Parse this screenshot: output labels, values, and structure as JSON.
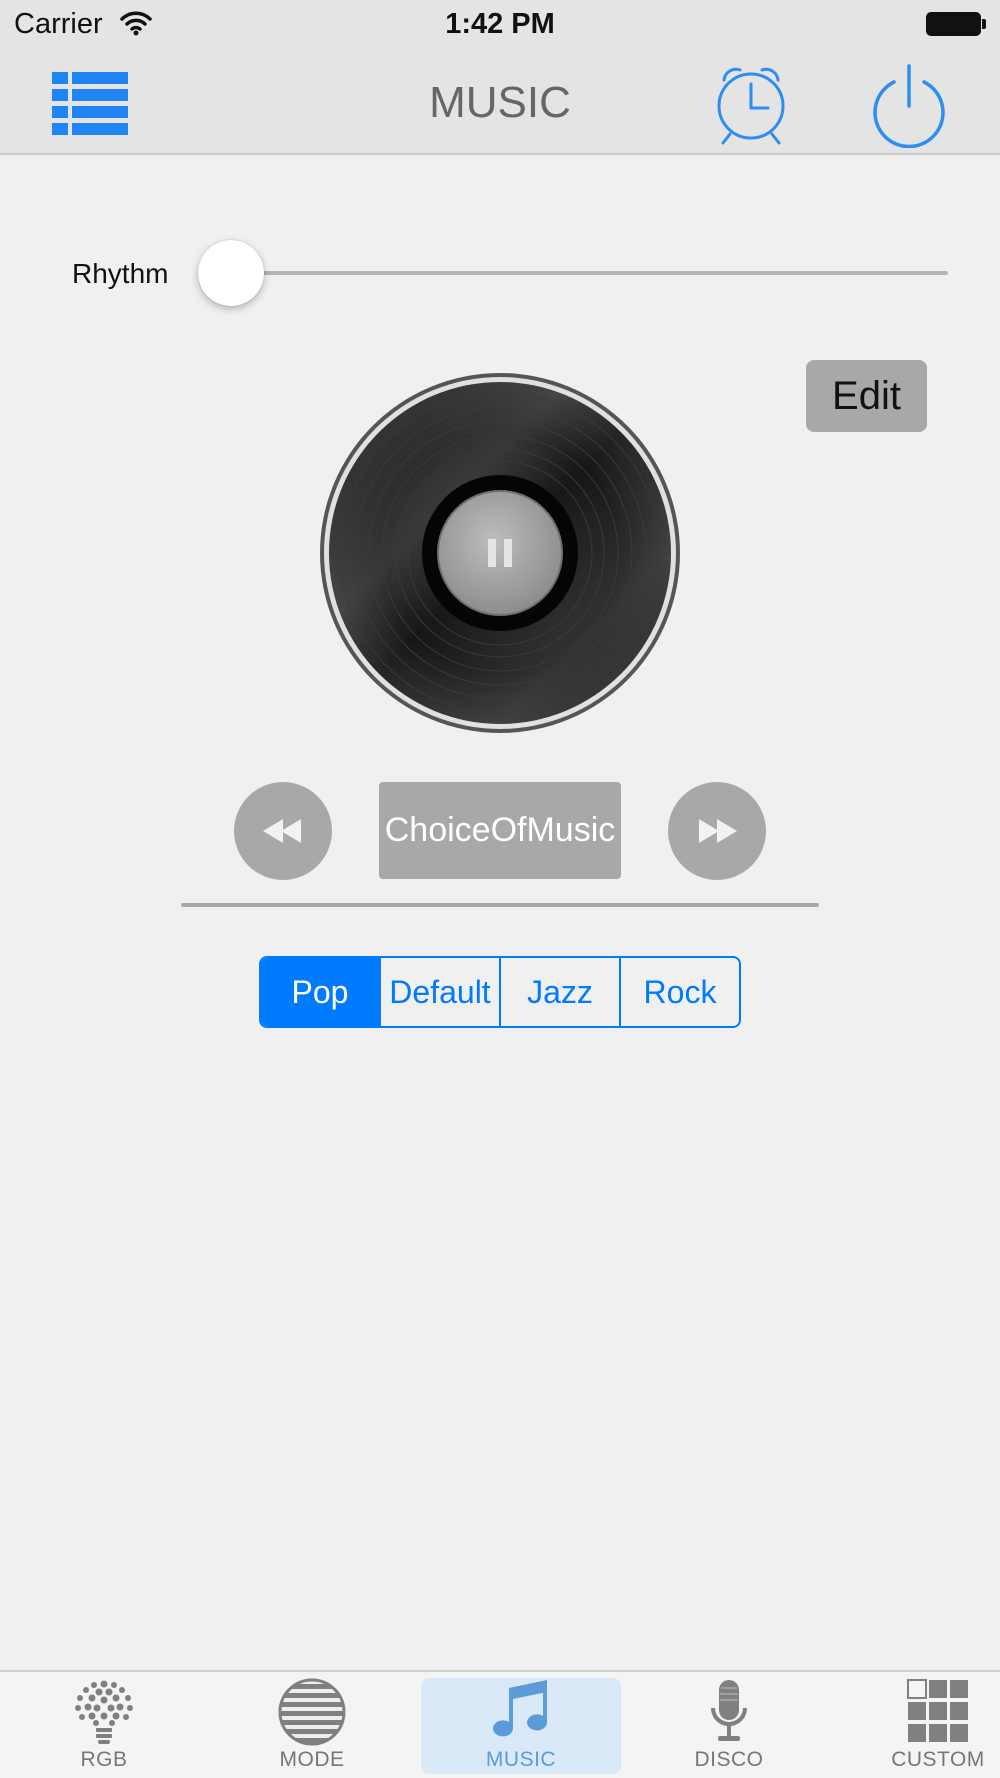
{
  "status_bar": {
    "carrier": "Carrier",
    "time": "1:42 PM"
  },
  "nav": {
    "title": "MUSIC",
    "icons": {
      "menu": "list-icon",
      "alarm": "alarm-clock-icon",
      "power": "power-icon"
    }
  },
  "rhythm": {
    "label": "Rhythm",
    "value": 0
  },
  "edit_label": "Edit",
  "player": {
    "state_icon": "pause-icon",
    "prev_icon": "rewind-icon",
    "next_icon": "fast-forward-icon",
    "choice_label": "ChoiceOfMusic"
  },
  "genres": {
    "options": [
      "Pop",
      "Default",
      "Jazz",
      "Rock"
    ],
    "selected": "Pop"
  },
  "tabs": [
    {
      "label": "RGB",
      "icon": "lightbulb-dots-icon"
    },
    {
      "label": "MODE",
      "icon": "striped-circle-icon"
    },
    {
      "label": "MUSIC",
      "icon": "music-note-icon",
      "active": true
    },
    {
      "label": "DISCO",
      "icon": "microphone-icon"
    },
    {
      "label": "CUSTOM",
      "icon": "grid-icon"
    }
  ],
  "colors": {
    "accent": "#007aff",
    "icon_blue": "#2b8ef0",
    "button_gray": "#a8a8a8",
    "active_tab_label": "#5b9bd8"
  }
}
